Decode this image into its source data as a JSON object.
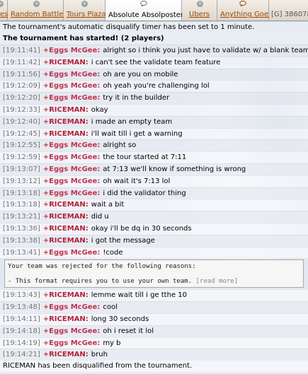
{
  "tabs": [
    {
      "label": "es",
      "icon": "close-icon"
    },
    {
      "label": "Random Battles",
      "icon": "close-icon"
    },
    {
      "label": "Tours Plaza",
      "icon": "close-icon"
    },
    {
      "label": "Absolute Absolposters",
      "icon": "chat-bubble-icon"
    },
    {
      "label": "Ubers",
      "icon": "close-icon"
    },
    {
      "label": "Anything Goes",
      "icon": "chat-bubble-icon"
    },
    {
      "label": "[G] 386078",
      "icon": ""
    }
  ],
  "notices": {
    "timer": "The tournament's automatic disqualify timer has been set to 1 minute.",
    "started": "The tournament has started! (2 players)",
    "dq": "RICEMAN has been disqualified from the tournament."
  },
  "rank_symbol": "+",
  "messages": [
    {
      "time": "[19:11:41]",
      "user": "Eggs McGee:",
      "text": "alright so i think you just have to validate w/ a blank team"
    },
    {
      "time": "[19:11:42]",
      "user": "RICEMAN:",
      "text": "i can't see the validate team feature"
    },
    {
      "time": "[19:11:56]",
      "user": "Eggs McGee:",
      "text": "oh are you on mobile"
    },
    {
      "time": "[19:12:09]",
      "user": "Eggs McGee:",
      "text": "oh yeah you're challenging lol"
    },
    {
      "time": "[19:12:20]",
      "user": "Eggs McGee:",
      "text": "try it in the builder"
    },
    {
      "time": "[19:12:33]",
      "user": "RICEMAN:",
      "text": "okay"
    },
    {
      "time": "[19:12:40]",
      "user": "RICEMAN:",
      "text": "i made an empty team"
    },
    {
      "time": "[19:12:45]",
      "user": "RICEMAN:",
      "text": "i'll wait till i get a warning"
    },
    {
      "time": "[19:12:55]",
      "user": "Eggs McGee:",
      "text": "alright so"
    },
    {
      "time": "[19:12:59]",
      "user": "Eggs McGee:",
      "text": "the tour started at 7:11"
    },
    {
      "time": "[19:13:07]",
      "user": "Eggs McGee:",
      "text": "at 7:13 we'll know if something is wrong"
    },
    {
      "time": "[19:13:12]",
      "user": "Eggs McGee:",
      "text": "oh wait it's 7:13 lol"
    },
    {
      "time": "[19:13:18]",
      "user": "Eggs McGee:",
      "text": "i did the validator thing"
    },
    {
      "time": "[19:13:18]",
      "user": "RICEMAN:",
      "text": "wait a bit"
    },
    {
      "time": "[19:13:21]",
      "user": "RICEMAN:",
      "text": "did u"
    },
    {
      "time": "[19:13:36]",
      "user": "RICEMAN:",
      "text": "okay i'll be dq in 30 seconds"
    },
    {
      "time": "[19:13:38]",
      "user": "RICEMAN:",
      "text": "i got the message"
    },
    {
      "time": "[19:13:41]",
      "user": "Eggs McGee:",
      "text": "!code"
    }
  ],
  "rejection": {
    "line1": "Your team was rejected for the following reasons:",
    "line2": "- This format requires you to use your own team.",
    "more": "[read more]"
  },
  "messages_after": [
    {
      "time": "[19:13:43]",
      "user": "RICEMAN:",
      "text": "lemme wait till i ge tthe 10"
    },
    {
      "time": "[19:13:48]",
      "user": "Eggs McGee:",
      "text": "cool"
    },
    {
      "time": "[19:14:11]",
      "user": "RICEMAN:",
      "text": "long 30 seconds"
    },
    {
      "time": "[19:14:18]",
      "user": "Eggs McGee:",
      "text": "oh i reset it lol"
    },
    {
      "time": "[19:14:19]",
      "user": "Eggs McGee:",
      "text": "my b"
    },
    {
      "time": "[19:14:21]",
      "user": "RICEMAN:",
      "text": "bruh"
    }
  ],
  "colors": {
    "eggs": "#c0334f",
    "riceman": "#b3213a",
    "tab_text": "#9b4a00"
  }
}
